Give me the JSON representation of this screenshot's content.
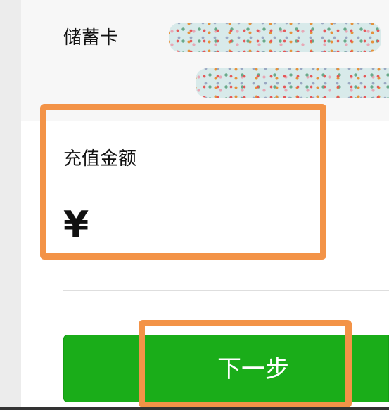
{
  "card": {
    "type_label": "储蓄卡"
  },
  "recharge": {
    "amount_label": "充值金额",
    "currency_symbol": "¥",
    "amount_value": ""
  },
  "actions": {
    "next_label": "下一步"
  },
  "colors": {
    "primary_button": "#1aad19",
    "highlight": "#f39347",
    "card_section_bg": "#f7f7f7",
    "page_side_bg": "#ececec"
  }
}
